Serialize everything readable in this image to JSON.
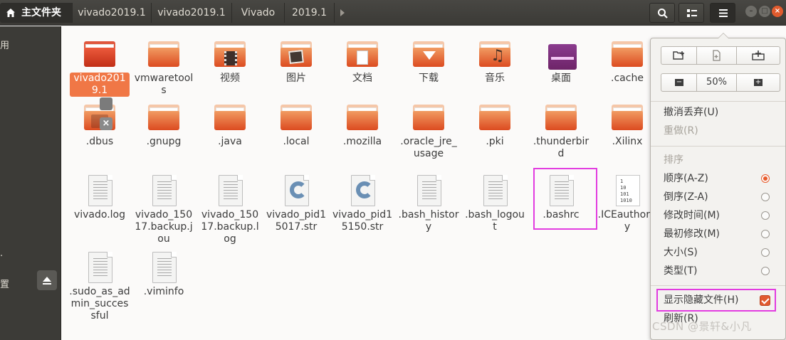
{
  "breadcrumb": {
    "home_label": "主文件夹",
    "items": [
      "vivado2019.1",
      "vivado2019.1",
      "Vivado",
      "2019.1"
    ]
  },
  "sidebar": {
    "labels": [
      "用",
      ".",
      "置"
    ]
  },
  "files": [
    {
      "name": "vivado2019.1",
      "type": "folder",
      "selected": true
    },
    {
      "name": "vmwaretools",
      "type": "folder"
    },
    {
      "name": "视频",
      "type": "folder-videos"
    },
    {
      "name": "图片",
      "type": "folder-pictures"
    },
    {
      "name": "文档",
      "type": "folder-documents"
    },
    {
      "name": "下载",
      "type": "folder-downloads"
    },
    {
      "name": "音乐",
      "type": "folder-music"
    },
    {
      "name": "桌面",
      "type": "folder-desktop"
    },
    {
      "name": ".cache",
      "type": "folder"
    },
    {
      "name": ".dbus",
      "type": "folder-locked"
    },
    {
      "name": ".gnupg",
      "type": "folder"
    },
    {
      "name": ".java",
      "type": "folder"
    },
    {
      "name": ".local",
      "type": "folder"
    },
    {
      "name": ".mozilla",
      "type": "folder"
    },
    {
      "name": ".oracle_jre_usage",
      "type": "folder"
    },
    {
      "name": ".pki",
      "type": "folder"
    },
    {
      "name": ".thunderbird",
      "type": "folder"
    },
    {
      "name": ".Xilinx",
      "type": "folder"
    },
    {
      "name": "vivado.log",
      "type": "text"
    },
    {
      "name": "vivado_15017.backup.jou",
      "type": "text"
    },
    {
      "name": "vivado_15017.backup.log",
      "type": "text"
    },
    {
      "name": "vivado_pid15017.str",
      "type": "c-source"
    },
    {
      "name": "vivado_pid15150.str",
      "type": "c-source"
    },
    {
      "name": ".bash_history",
      "type": "text"
    },
    {
      "name": ".bash_logout",
      "type": "text"
    },
    {
      "name": ".bashrc",
      "type": "text",
      "highlighted": true
    },
    {
      "name": ".ICEauthority",
      "type": "binary"
    },
    {
      "name": ".sudo_as_admin_successful",
      "type": "text"
    },
    {
      "name": ".viminfo",
      "type": "text"
    }
  ],
  "binary_icon_text": [
    "1",
    "10",
    "101",
    "1010"
  ],
  "menu": {
    "zoom_value": "50%",
    "undo": "撤消丢弃(U)",
    "redo": "重做(R)",
    "sort_header": "排序",
    "sort_options": [
      {
        "label": "顺序(A-Z)",
        "selected": true
      },
      {
        "label": "倒序(Z-A)",
        "selected": false
      },
      {
        "label": "修改时间(M)",
        "selected": false
      },
      {
        "label": "最初修改(M)",
        "selected": false
      },
      {
        "label": "大小(S)",
        "selected": false
      },
      {
        "label": "类型(T)",
        "selected": false
      }
    ],
    "show_hidden": "显示隐藏文件(H)",
    "show_hidden_checked": true,
    "refresh": "刷新(R)"
  },
  "watermark": "CSDN @景轩&小凡",
  "colors": {
    "accent": "#f07746",
    "highlight_box": "#e23ce0",
    "titlebar": "#3b3a36"
  }
}
